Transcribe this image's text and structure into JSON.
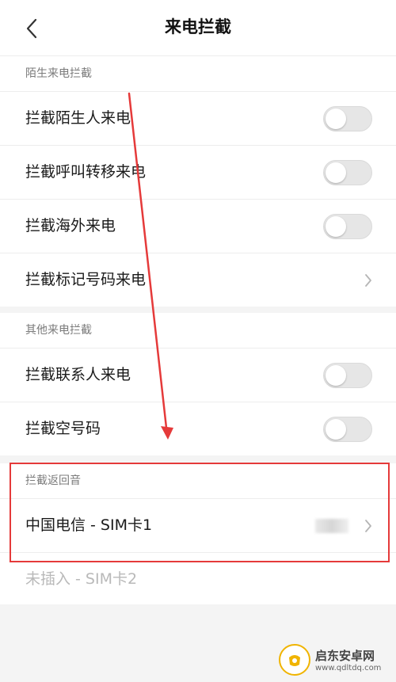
{
  "header": {
    "title": "来电拦截"
  },
  "sections": [
    {
      "header": "陌生来电拦截",
      "items": [
        {
          "label": "拦截陌生人来电",
          "control": "toggle",
          "on": false
        },
        {
          "label": "拦截呼叫转移来电",
          "control": "toggle",
          "on": false
        },
        {
          "label": "拦截海外来电",
          "control": "toggle",
          "on": false
        },
        {
          "label": "拦截标记号码来电",
          "control": "chevron"
        }
      ]
    },
    {
      "header": "其他来电拦截",
      "items": [
        {
          "label": "拦截联系人来电",
          "control": "toggle",
          "on": false
        },
        {
          "label": "拦截空号码",
          "control": "toggle",
          "on": false
        }
      ]
    },
    {
      "header": "拦截返回音",
      "items": [
        {
          "label": "中国电信 - SIM卡1",
          "control": "chevron",
          "value": "(blurred)"
        },
        {
          "label": "未插入 - SIM卡2",
          "control": "none",
          "disabled": true
        }
      ]
    }
  ],
  "watermark": {
    "title": "启东安卓网",
    "url": "www.qdltdq.com"
  },
  "colors": {
    "annotation": "#e53a3a",
    "toggle_off": "#e6e6e6",
    "text": "#1a1a1a",
    "muted": "#7b7b7b"
  }
}
